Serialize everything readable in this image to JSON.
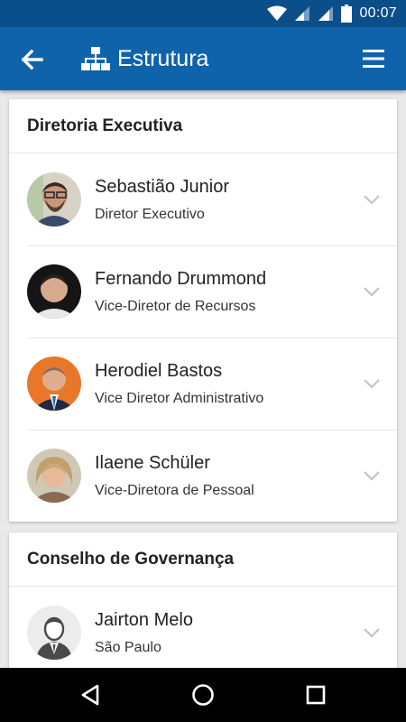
{
  "status": {
    "time": "00:07",
    "icons": [
      "wifi-icon",
      "signal-icon",
      "signal-icon",
      "battery-icon"
    ]
  },
  "app_bar": {
    "title": "Estrutura",
    "back_icon": "arrow-left-icon",
    "title_icon": "org-chart-icon",
    "menu_icon": "hamburger-menu-icon"
  },
  "sections": [
    {
      "title": "Diretoria Executiva",
      "members": [
        {
          "name": "Sebastião Junior",
          "role": "Diretor Executivo"
        },
        {
          "name": "Fernando Drummond",
          "role": "Vice-Diretor de Recursos"
        },
        {
          "name": "Herodiel Bastos",
          "role": "Vice Diretor Administrativo"
        },
        {
          "name": "Ilaene Schüler",
          "role": "Vice-Diretora de Pessoal"
        }
      ]
    },
    {
      "title": "Conselho de Governança",
      "members": [
        {
          "name": "Jairton Melo",
          "role": "São Paulo"
        }
      ]
    }
  ],
  "colors": {
    "status_bar": "#0b4f8a",
    "app_bar": "#0f63aa",
    "background": "#e9e9e9",
    "chevron": "#c4c4c4"
  },
  "nav": {
    "icons": [
      "back-triangle-icon",
      "home-circle-icon",
      "recents-square-icon"
    ]
  }
}
